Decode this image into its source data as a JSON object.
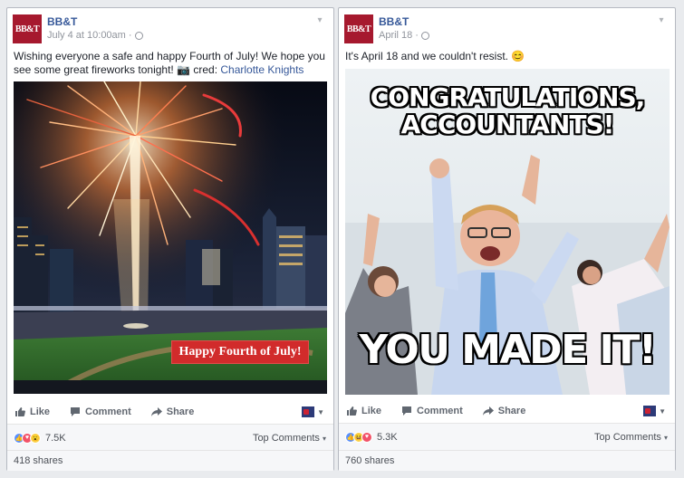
{
  "posts": [
    {
      "page_name": "BB&T",
      "avatar_text": "BB&T",
      "timestamp": "July 4 at 10:00am",
      "message_text": "Wishing everyone a safe and happy Fourth of July! We hope you see some great fireworks tonight! 📷 cred: ",
      "message_link": "Charlotte Knights",
      "image_caption": "Happy Fourth of July!",
      "like_label": "Like",
      "comment_label": "Comment",
      "share_label": "Share",
      "reaction_count": "7.5K",
      "top_comments_label": "Top Comments",
      "shares_label": "418 shares"
    },
    {
      "page_name": "BB&T",
      "avatar_text": "BB&T",
      "timestamp": "April 18",
      "message_text": "It's April 18 and we couldn't resist. 😊",
      "image_top_text_1": "CONGRATULATIONS,",
      "image_top_text_2": "ACCOUNTANTS!",
      "image_bottom_text": "YOU MADE IT!",
      "like_label": "Like",
      "comment_label": "Comment",
      "share_label": "Share",
      "reaction_count": "5.3K",
      "top_comments_label": "Top Comments",
      "shares_label": "760 shares"
    }
  ],
  "colors": {
    "brand": "#a6192e",
    "link": "#365899",
    "like_blue": "#5890ff",
    "love_red": "#f25268"
  },
  "icons": [
    "globe-icon",
    "chevron-down-icon",
    "thumbs-up-icon",
    "comment-icon",
    "share-icon",
    "like-reaction-icon",
    "love-reaction-icon",
    "wow-reaction-icon",
    "haha-reaction-icon"
  ]
}
